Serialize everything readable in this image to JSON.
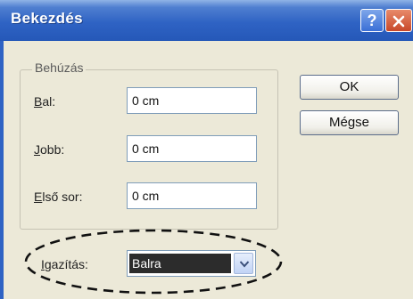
{
  "window": {
    "title": "Bekezdés",
    "help_label": "?"
  },
  "indent": {
    "group_title": "Behúzás",
    "left": {
      "label_u": "B",
      "label_rest": "al:",
      "value": "0 cm"
    },
    "right": {
      "label_u": "J",
      "label_rest": "obb:",
      "value": "0 cm"
    },
    "first_line": {
      "label_u": "E",
      "label_rest": "lső sor:",
      "value": "0 cm"
    }
  },
  "buttons": {
    "ok": "OK",
    "cancel": "Mégse"
  },
  "alignment": {
    "label_u": "I",
    "label_rest": "gazítás:",
    "selected": "Balra"
  },
  "colors": {
    "titlebar": "#2f63c4",
    "dialog_bg": "#ece9d8",
    "selection": "#2c2c2c"
  }
}
